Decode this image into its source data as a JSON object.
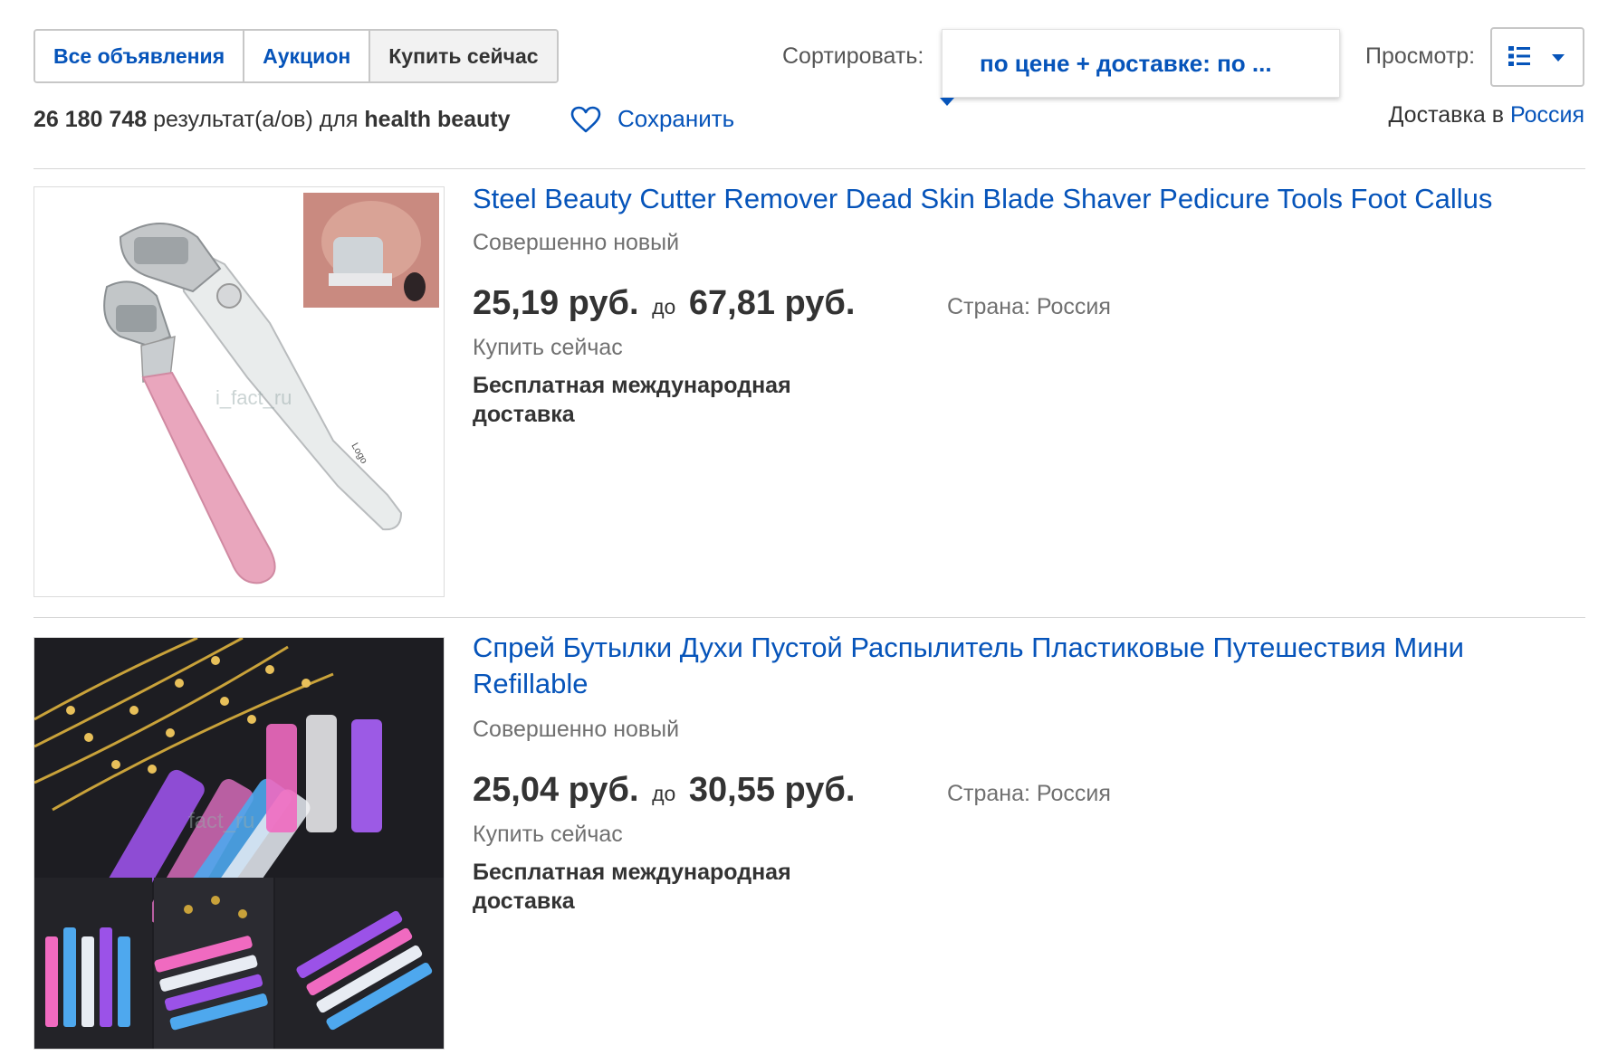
{
  "tabs": [
    {
      "label": "Все объявления",
      "active": false
    },
    {
      "label": "Аукцион",
      "active": false
    },
    {
      "label": "Купить сейчас",
      "active": true
    }
  ],
  "sort": {
    "label": "Сортировать:",
    "value": "по цене + доставке: по ..."
  },
  "view": {
    "label": "Просмотр:",
    "icon": "list-view-icon"
  },
  "results": {
    "count": "26 180 748",
    "middle": " результат(а/ов) для ",
    "query": "health beauty"
  },
  "save": {
    "label": "Сохранить",
    "icon": "heart-icon"
  },
  "delivery": {
    "prefix": "Доставка в ",
    "country": "Россия"
  },
  "items": [
    {
      "title": "Steel Beauty Cutter Remover Dead Skin Blade Shaver Pedicure Tools Foot Callus",
      "condition": "Совершенно новый",
      "price_from": "25,19 руб.",
      "price_to_word": "до",
      "price_to": "67,81 руб.",
      "buy_format": "Купить сейчас",
      "shipping": "Бесплатная международная доставка",
      "country": "Страна: Россия",
      "image_watermark": "i_fact_ru",
      "image_logo": "Logo"
    },
    {
      "title": "Спрей Бутылки Духи Пустой Распылитель Пластиковые Путешествия Мини Refillable",
      "condition": "Совершенно новый",
      "price_from": "25,04 руб.",
      "price_to_word": "до",
      "price_to": "30,55 руб.",
      "buy_format": "Купить сейчас",
      "shipping": "Бесплатная международная доставка",
      "country": "Страна: Россия",
      "image_watermark": "fact_ru"
    }
  ],
  "colors": {
    "link": "#0654ba",
    "text": "#333333",
    "muted": "#707070",
    "border": "#c7c7c7"
  }
}
